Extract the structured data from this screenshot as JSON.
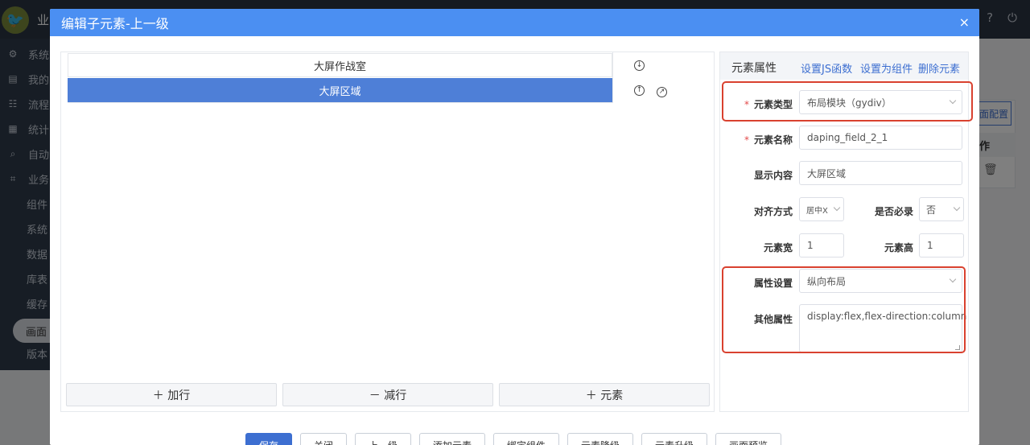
{
  "app": {
    "logo_glyph": "🐦",
    "name": "业",
    "top_icons": [
      "help-icon",
      "power-icon"
    ],
    "sidebar": {
      "items": [
        {
          "icon": "⚙",
          "label": "系统"
        },
        {
          "icon": "▤",
          "label": "我的"
        },
        {
          "icon": "☷",
          "label": "流程"
        },
        {
          "icon": "▦",
          "label": "统计"
        },
        {
          "icon": "⌕",
          "label": "自动"
        },
        {
          "icon": "⌗",
          "label": "业务"
        }
      ],
      "sub_items": [
        "组件",
        "系统",
        "数据",
        "库表",
        "缓存"
      ],
      "active_item": "画面",
      "after_active": "版本"
    },
    "bg": {
      "config_button": "面配置",
      "header_col": "作",
      "trash_icon": "🗑"
    }
  },
  "dialog": {
    "title": "编辑子元素-上一级",
    "close_glyph": "×",
    "tree_rows": [
      {
        "label": "大屏作战室",
        "selected": false
      },
      {
        "label": "大屏区域",
        "selected": true
      }
    ],
    "row_controls": {
      "down": "↓",
      "up": "↑",
      "link": "↗"
    },
    "bottom_buttons": [
      "＋ 加行",
      "－ 减行",
      "＋ 元素"
    ],
    "props": {
      "title": "元素属性",
      "links": [
        "设置JS函数",
        "设置为组件",
        "删除元素"
      ],
      "element_type_label": "元素类型",
      "element_type_value": "布局模块（gydiv）",
      "element_name_label": "元素名称",
      "element_name_value": "daping_field_2_1",
      "display_label": "显示内容",
      "display_value": "大屏区域",
      "align_label": "对齐方式",
      "align_value": "居中X",
      "required_label": "是否必录",
      "required_value": "否",
      "width_label": "元素宽",
      "width_value": "1",
      "height_label": "元素高",
      "height_value": "1",
      "attr_label": "属性设置",
      "attr_value": "纵向布局",
      "other_label": "其他属性",
      "other_value": "display:flex,flex-direction:column"
    },
    "footer_buttons": [
      "保存",
      "关闭",
      "上一级",
      "添加元素",
      "绑定组件",
      "元素降级",
      "元素升级",
      "画面预览"
    ]
  },
  "colors": {
    "header": "#4b8ff2",
    "selected_row": "#4e7fd7",
    "link": "#3d6fd1",
    "highlight": "#d9412f",
    "required": "#e24a4a"
  }
}
